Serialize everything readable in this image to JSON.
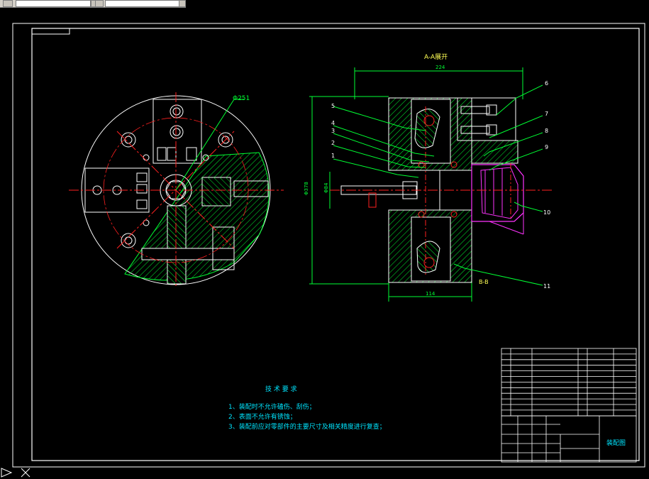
{
  "toolbar": {
    "combo1_value": "",
    "combo2_value": ""
  },
  "drawing": {
    "section_label": "A-A展开",
    "section_label_bb": "B-B",
    "diameter_callout": "Φ251",
    "dim_top": "224",
    "dim_bottom": "114",
    "dim_left_outer": "Φ378",
    "dim_left_inner": "Φ84",
    "part_callouts": [
      "1",
      "2",
      "3",
      "4",
      "5",
      "6",
      "7",
      "8",
      "9",
      "10",
      "11"
    ]
  },
  "notes": {
    "title": "技 术 要 求",
    "lines": [
      "1、装配时不允许磕伤、刮伤；",
      "2、表面不允许有锈蚀；",
      "3、装配前应对零部件的主要尺寸及相关精度进行复查；"
    ]
  },
  "title_block": {
    "drawing_name": "装配图"
  },
  "colors": {
    "outline": "#ffffff",
    "centerline": "#ff2020",
    "hatch": "#00ff33",
    "annotation": "#00e5ff",
    "magenta_part": "#ff33ff",
    "section_label": "#ffff55"
  }
}
